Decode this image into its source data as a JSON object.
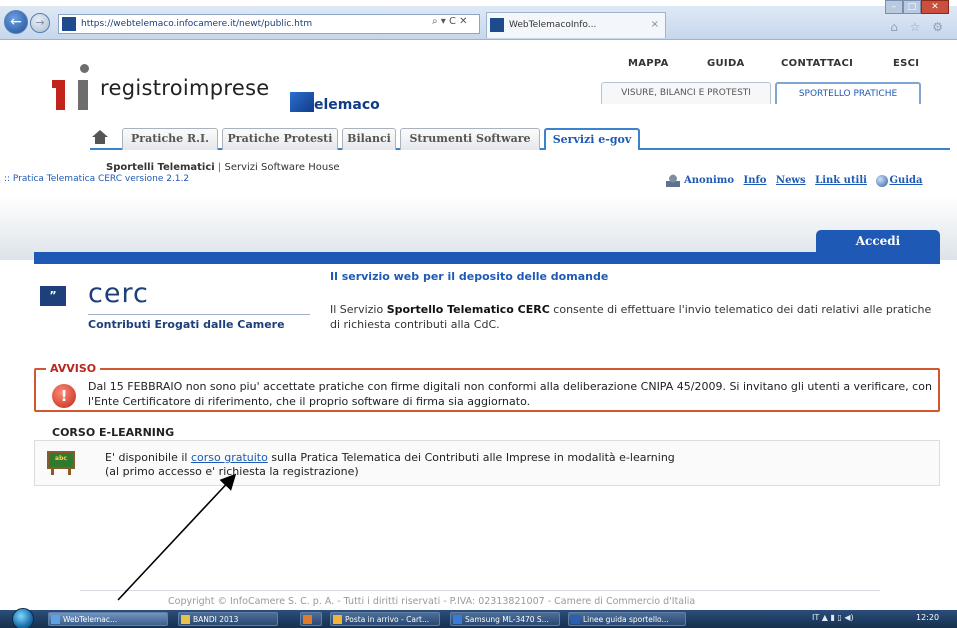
{
  "browser": {
    "url": "https://webtelemaco.infocamere.it/newt/public.htm",
    "address_controls": "⌕ ▾ C ✕",
    "tab_title": "WebTelemacoInfo...",
    "tab_close": "×"
  },
  "header": {
    "logo_text": "registroimprese",
    "telemaco_text": "elemaco",
    "top_links": [
      "MAPPA",
      "GUIDA",
      "CONTATTACI",
      "ESCI"
    ],
    "sub_tabs": [
      "VISURE, BILANCI E PROTESTI",
      "SPORTELLO PRATICHE"
    ]
  },
  "menu": {
    "tabs": [
      "Pratiche R.I.",
      "Pratiche Protesti",
      "Bilanci",
      "Strumenti Software",
      "Servizi e-gov"
    ],
    "active_tab": "Servizi e-gov"
  },
  "subheader": {
    "sportelli": "Sportelli Telematici",
    "separator": "|",
    "servizi": "Servizi Software House",
    "breadcrumb": ":: Pratica Telematica CERC versione 2.1.2"
  },
  "user_links": {
    "anonimo": "Anonimo",
    "links": [
      "Info",
      "News",
      "Link utili"
    ],
    "guida": "Guida"
  },
  "accedi": "Accedi",
  "cerc": {
    "badge": "”",
    "name": "cerc",
    "subtitle": "Contributi Erogati dalle Camere"
  },
  "service": {
    "title": "Il servizio web per il deposito delle domande",
    "text_prefix": "Il Servizio ",
    "text_bold": "Sportello Telematico CERC",
    "text_suffix": " consente di effettuare l'invio telematico dei dati relativi alle pratiche di richiesta contributi alla CdC."
  },
  "avviso": {
    "title": "AVVISO",
    "icon": "!",
    "text": "Dal 15 FEBBRAIO non sono piu' accettate pratiche con firme digitali non conformi alla deliberazione CNIPA 45/2009. Si invitano gli utenti a verificare, con l'Ente Certificatore di riferimento, che il proprio software di firma sia aggiornato."
  },
  "corso": {
    "title": "CORSO E-LEARNING",
    "board_text": "abc",
    "text_prefix": "E' disponibile il ",
    "link": "corso gratuito",
    "text_suffix": " sulla Pratica Telematica dei Contributi alle Imprese in modalità e-learning",
    "text_line2": "(al primo accesso e' richiesta la registrazione)"
  },
  "footer": {
    "text": "Copyright © InfoCamere S. C. p. A. - Tutti i diritti riservati - P.IVA: 02313821007 - Camere di Commercio d'Italia"
  },
  "taskbar": {
    "items": [
      "WebTelemac...",
      "BANDI 2013",
      "",
      "Posta in arrivo - Cart...",
      "Samsung ML-3470 S...",
      "Linee guida sportello..."
    ],
    "tray": "IT  ▲  ▮  ▯  ◀)",
    "clock": "12:20"
  },
  "colors": {
    "accent_blue": "#1e5ab5",
    "logo_red": "#c2231a",
    "warning_red": "#b8281f",
    "warning_border": "#d0582f"
  }
}
